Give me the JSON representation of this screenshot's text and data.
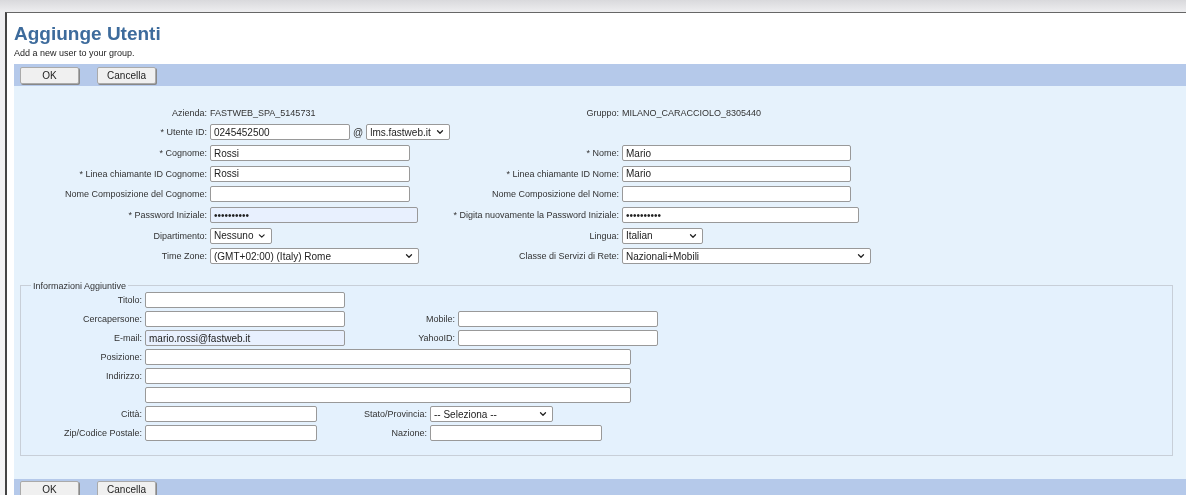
{
  "title": "Aggiunge Utenti",
  "subtitle": "Add a new user to your group.",
  "top_buttons": [
    "OK",
    "Cancella"
  ],
  "main_rows": [
    {
      "left": {
        "label": "Azienda:",
        "kind": "static",
        "value": "FASTWEB_SPA_5145731"
      },
      "right": {
        "label": "Gruppo:",
        "kind": "static",
        "value": "MILANO_CARACCIOLO_8305440"
      }
    },
    {
      "left": {
        "label": "* Utente ID:",
        "kind": "user_id",
        "value": "0245452500",
        "at": "@",
        "domain": "lms.fastweb.it"
      }
    },
    {
      "left": {
        "label": "* Cognome:",
        "kind": "text",
        "value": "Rossi"
      },
      "right": {
        "label": "* Nome:",
        "kind": "text",
        "value": "Mario"
      }
    },
    {
      "left": {
        "label": "* Linea chiamante ID Cognome:",
        "kind": "text",
        "value": "Rossi"
      },
      "right": {
        "label": "* Linea chiamante ID Nome:",
        "kind": "text",
        "value": "Mario"
      }
    },
    {
      "left": {
        "label": "Nome Composizione del Cognome:",
        "kind": "text"
      },
      "right": {
        "label": "Nome Composizione del Nome:",
        "kind": "text"
      }
    },
    {
      "left": {
        "label": "* Password Iniziale:",
        "kind": "password",
        "value": "••••••••••",
        "autofilled": true
      },
      "right": {
        "label": "* Digita nuovamente la Password Iniziale:",
        "kind": "password",
        "value": "••••••••••",
        "autofilled": false
      }
    },
    {
      "left": {
        "label": "Dipartimento:",
        "kind": "select",
        "value": "Nessuno"
      },
      "right": {
        "label": "Lingua:",
        "kind": "select",
        "value": "Italian"
      }
    },
    {
      "left": {
        "label": "Time Zone:",
        "kind": "select",
        "value": "(GMT+02:00) (Italy) Rome"
      },
      "right": {
        "label": "Classe di Servizi di Rete:",
        "kind": "select",
        "value": "Nazionali+Mobili"
      }
    }
  ],
  "additional": {
    "legend": "Informazioni Aggiuntive",
    "rows": [
      {
        "left": {
          "label": "Titolo:",
          "kind": "text"
        }
      },
      {
        "left": {
          "label": "Cercapersone:",
          "kind": "text"
        },
        "right": {
          "label": "Mobile:",
          "kind": "text"
        }
      },
      {
        "left": {
          "label": "E-mail:",
          "kind": "text",
          "value": "mario.rossi@fastweb.it",
          "autofilled": true
        },
        "right": {
          "label": "YahooID:",
          "kind": "text"
        }
      },
      {
        "left": {
          "label": "Posizione:",
          "kind": "text"
        }
      },
      {
        "left": {
          "label": "Indirizzo:",
          "kind": "text"
        }
      },
      {
        "left": {
          "kind": "text"
        }
      },
      {
        "left": {
          "label": "Città:",
          "kind": "text"
        },
        "right": {
          "label": "Stato/Provincia:",
          "kind": "select",
          "value": "-- Seleziona --"
        }
      },
      {
        "left": {
          "label": "Zip/Codice Postale:",
          "kind": "text"
        },
        "right": {
          "label": "Nazione:",
          "kind": "text"
        }
      }
    ]
  },
  "bottom_buttons": [
    "OK",
    "Cancella"
  ]
}
